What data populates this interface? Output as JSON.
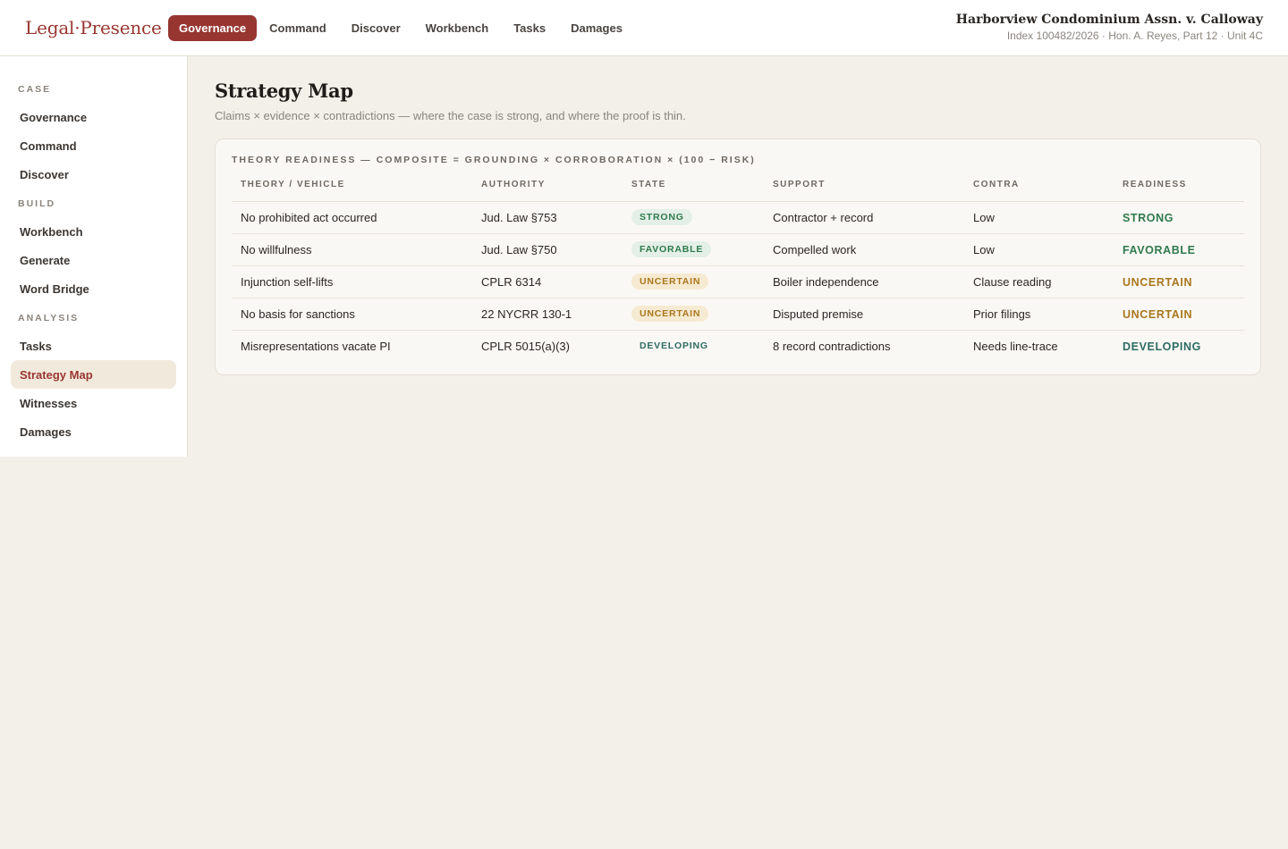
{
  "brand": {
    "part1": "Legal",
    "sep": "·",
    "part2": "Presence"
  },
  "topnav": [
    "Governance",
    "Command",
    "Discover",
    "Workbench",
    "Tasks",
    "Damages"
  ],
  "case": {
    "title": "Harborview Condominium Assn. v. Calloway",
    "subtitle": "Index 100482/2026 · Hon. A. Reyes, Part 12 · Unit 4C"
  },
  "sidebar": {
    "sections": [
      {
        "label": "CASE",
        "items": [
          "Governance",
          "Command",
          "Discover"
        ]
      },
      {
        "label": "BUILD",
        "items": [
          "Workbench",
          "Generate",
          "Word Bridge"
        ]
      },
      {
        "label": "ANALYSIS",
        "items": [
          "Tasks",
          "Strategy Map",
          "Witnesses",
          "Damages"
        ]
      }
    ],
    "active": "Strategy Map"
  },
  "page": {
    "title": "Strategy Map",
    "subtitle": "Claims × evidence × contradictions — where the case is strong, and where the proof is thin."
  },
  "card": {
    "title": "THEORY READINESS — COMPOSITE = GROUNDING × CORROBORATION × (100 − RISK)",
    "columns": [
      "THEORY / VEHICLE",
      "AUTHORITY",
      "STATE",
      "SUPPORT",
      "CONTRA",
      "READINESS"
    ],
    "rows": [
      {
        "theory": "No prohibited act occurred",
        "authority": "Jud. Law §753",
        "state": "STRONG",
        "support": "Contractor + record",
        "contra": "Low",
        "readiness": "STRONG"
      },
      {
        "theory": "No willfulness",
        "authority": "Jud. Law §750",
        "state": "FAVORABLE",
        "support": "Compelled work",
        "contra": "Low",
        "readiness": "FAVORABLE"
      },
      {
        "theory": "Injunction self-lifts",
        "authority": "CPLR 6314",
        "state": "UNCERTAIN",
        "support": "Boiler independence",
        "contra": "Clause reading",
        "readiness": "UNCERTAIN"
      },
      {
        "theory": "No basis for sanctions",
        "authority": "22 NYCRR 130-1",
        "state": "UNCERTAIN",
        "support": "Disputed premise",
        "contra": "Prior filings",
        "readiness": "UNCERTAIN"
      },
      {
        "theory": "Misrepresentations vacate PI",
        "authority": "CPLR 5015(a)(3)",
        "state": "DEVELOPING",
        "support": "8 record contradictions",
        "contra": "Needs line-trace",
        "readiness": "DEVELOPING"
      }
    ]
  },
  "colors": {
    "accent": "#973631",
    "strong": "#2f7a4f",
    "uncertain": "#a9771e",
    "developing": "#2d6b62"
  }
}
